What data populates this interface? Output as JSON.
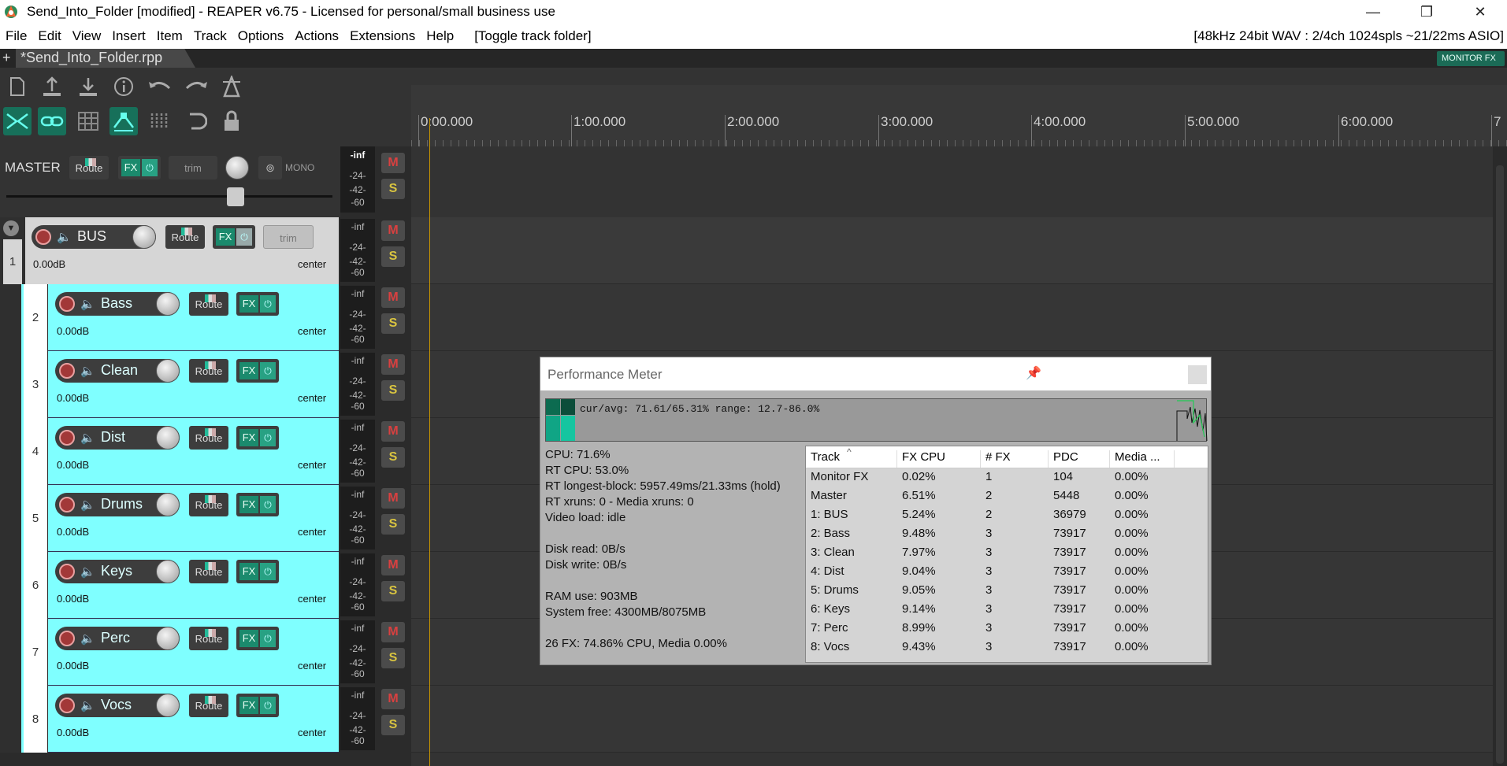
{
  "window": {
    "title": "Send_Into_Folder [modified] - REAPER v6.75 - Licensed for personal/small business use",
    "minimize": "—",
    "maximize": "❐",
    "close": "✕"
  },
  "menu": [
    "File",
    "Edit",
    "View",
    "Insert",
    "Item",
    "Track",
    "Options",
    "Actions",
    "Extensions",
    "Help",
    "[Toggle track folder]"
  ],
  "audio_status": "[48kHz 24bit WAV : 2/4ch 1024spls ~21/22ms ASIO]",
  "project_tab": "*Send_Into_Folder.rpp",
  "add_tab": "+",
  "monitor_fx": "MONITOR FX",
  "toolbar_icons": [
    "new-project-icon",
    "save-project-icon",
    "open-project-icon",
    "project-info-icon",
    "undo-icon",
    "redo-icon",
    "metronome-icon",
    "ripple-edit-icon",
    "grouping-icon",
    "grid-icon",
    "auto-crossfade-icon",
    "snap-icon",
    "loop-icon",
    "lock-icon"
  ],
  "ruler": {
    "labels": [
      "0:00.000",
      "1:00.000",
      "2:00.000",
      "3:00.000",
      "4:00.000",
      "5:00.000",
      "6:00.000",
      "7"
    ]
  },
  "master": {
    "label": "MASTER",
    "route": "Route",
    "fx": "FX",
    "trim": "trim",
    "mono": "MONO",
    "meter_peak": "-inf",
    "meter_scale": [
      "-24-",
      "-42-",
      "-60"
    ]
  },
  "mute_label": "M",
  "solo_label": "S",
  "tracks": [
    {
      "num": "1",
      "name": "BUS",
      "vol": "0.00dB",
      "pan": "center",
      "route": "Route",
      "fx": "FX",
      "trim": "trim",
      "peak": "-inf"
    },
    {
      "num": "2",
      "name": "Bass",
      "vol": "0.00dB",
      "pan": "center",
      "route": "Route",
      "fx": "FX",
      "peak": "-inf"
    },
    {
      "num": "3",
      "name": "Clean",
      "vol": "0.00dB",
      "pan": "center",
      "route": "Route",
      "fx": "FX",
      "peak": "-inf"
    },
    {
      "num": "4",
      "name": "Dist",
      "vol": "0.00dB",
      "pan": "center",
      "route": "Route",
      "fx": "FX",
      "peak": "-inf"
    },
    {
      "num": "5",
      "name": "Drums",
      "vol": "0.00dB",
      "pan": "center",
      "route": "Route",
      "fx": "FX",
      "peak": "-inf"
    },
    {
      "num": "6",
      "name": "Keys",
      "vol": "0.00dB",
      "pan": "center",
      "route": "Route",
      "fx": "FX",
      "peak": "-inf"
    },
    {
      "num": "7",
      "name": "Perc",
      "vol": "0.00dB",
      "pan": "center",
      "route": "Route",
      "fx": "FX",
      "peak": "-inf"
    },
    {
      "num": "8",
      "name": "Vocs",
      "vol": "0.00dB",
      "pan": "center",
      "route": "Route",
      "fx": "FX",
      "peak": "-inf"
    }
  ],
  "perf": {
    "title": "Performance Meter",
    "graph_text": "cur/avg: 71.61/65.31%  range: 12.7-86.0%",
    "stats": [
      "CPU: 71.6%",
      "RT CPU: 53.0%",
      "RT longest-block: 5957.49ms/21.33ms (hold)",
      "RT xruns: 0 - Media xruns: 0",
      "Video load: idle",
      "Disk read: 0B/s",
      "Disk write: 0B/s",
      "RAM use: 903MB",
      "System free: 4300MB/8075MB",
      "26 FX: 74.86% CPU, Media 0.00%"
    ],
    "columns": [
      "Track",
      "FX CPU",
      "# FX",
      "PDC",
      "Media ..."
    ],
    "rows": [
      [
        "Monitor FX",
        "0.02%",
        "1",
        "104",
        "0.00%"
      ],
      [
        "Master",
        "6.51%",
        "2",
        "5448",
        "0.00%"
      ],
      [
        "1: BUS",
        "5.24%",
        "2",
        "36979",
        "0.00%"
      ],
      [
        "2: Bass",
        "9.48%",
        "3",
        "73917",
        "0.00%"
      ],
      [
        "3: Clean",
        "7.97%",
        "3",
        "73917",
        "0.00%"
      ],
      [
        "4: Dist",
        "9.04%",
        "3",
        "73917",
        "0.00%"
      ],
      [
        "5: Drums",
        "9.05%",
        "3",
        "73917",
        "0.00%"
      ],
      [
        "6: Keys",
        "9.14%",
        "3",
        "73917",
        "0.00%"
      ],
      [
        "7: Perc",
        "8.99%",
        "3",
        "73917",
        "0.00%"
      ],
      [
        "8: Vocs",
        "9.43%",
        "3",
        "73917",
        "0.00%"
      ]
    ]
  },
  "colors": {
    "track_color": "#7fffff",
    "bus_color": "#d6d6d6",
    "accent": "#17705a",
    "cursor": "#c89500"
  }
}
